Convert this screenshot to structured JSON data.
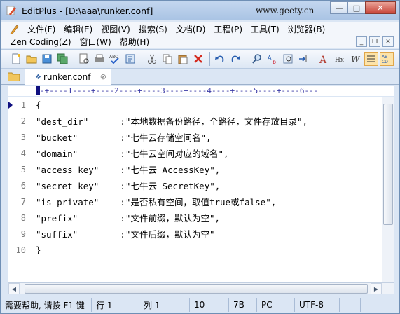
{
  "window": {
    "app_name": "EditPlus",
    "title": "EditPlus - [D:\\aaa\\runker.conf]",
    "watermark": "www.geety.cn"
  },
  "menu": {
    "row1": [
      "文件(F)",
      "编辑(E)",
      "视图(V)",
      "搜索(S)",
      "文档(D)",
      "工程(P)",
      "工具(T)",
      "浏览器(B)"
    ],
    "row2": [
      "Zen Coding(Z)",
      "窗口(W)",
      "帮助(H)"
    ]
  },
  "toolbar": {
    "icons": [
      "new-file-icon",
      "open-file-icon",
      "save-icon",
      "save-all-icon",
      "print-preview-icon",
      "print-icon",
      "spellcheck-icon",
      "browser-preview-icon",
      "cut-icon",
      "copy-icon",
      "paste-icon",
      "delete-icon",
      "undo-icon",
      "redo-icon",
      "find-icon",
      "replace-icon",
      "find-in-files-icon",
      "goto-icon",
      "font-size-icon",
      "hex-icon",
      "word-wrap-icon",
      "line-number-icon",
      "ruler-icon"
    ]
  },
  "tabs": [
    {
      "label": "runker.conf",
      "active": true
    }
  ],
  "ruler": "-+----1----+----2----+----3----+----4----+----5----+----6---",
  "editor": {
    "current_line": 1,
    "lines": [
      {
        "n": "1",
        "text": "{"
      },
      {
        "n": "2",
        "text": "\"dest_dir\"      :\"本地数据备份路径，全路径，文件存放目录\","
      },
      {
        "n": "3",
        "text": "\"bucket\"        :\"七牛云存储空间名\","
      },
      {
        "n": "4",
        "text": "\"domain\"        :\"七牛云空间对应的域名\","
      },
      {
        "n": "5",
        "text": "\"access_key\"    :\"七牛云 AccessKey\","
      },
      {
        "n": "6",
        "text": "\"secret_key\"    :\"七牛云 SecretKey\","
      },
      {
        "n": "7",
        "text": "\"is_private\"    :\"是否私有空间，取值true或false\","
      },
      {
        "n": "8",
        "text": "\"prefix\"        :\"文件前缀，默认为空\","
      },
      {
        "n": "9",
        "text": "\"suffix\"        :\"文件后缀，默认为空\""
      },
      {
        "n": "10",
        "text": "}"
      }
    ]
  },
  "status": {
    "help": "需要帮助, 请按 F1 键",
    "line": "行 1",
    "col": "列 1",
    "lines_total": "10",
    "size": "7B",
    "eol": "PC",
    "encoding": "UTF-8"
  },
  "colors": {
    "title_bg": "#b5cbe8",
    "close_button": "#c8463a",
    "ruler_text": "#3a3aa5",
    "line_number": "#7a7a7a"
  }
}
